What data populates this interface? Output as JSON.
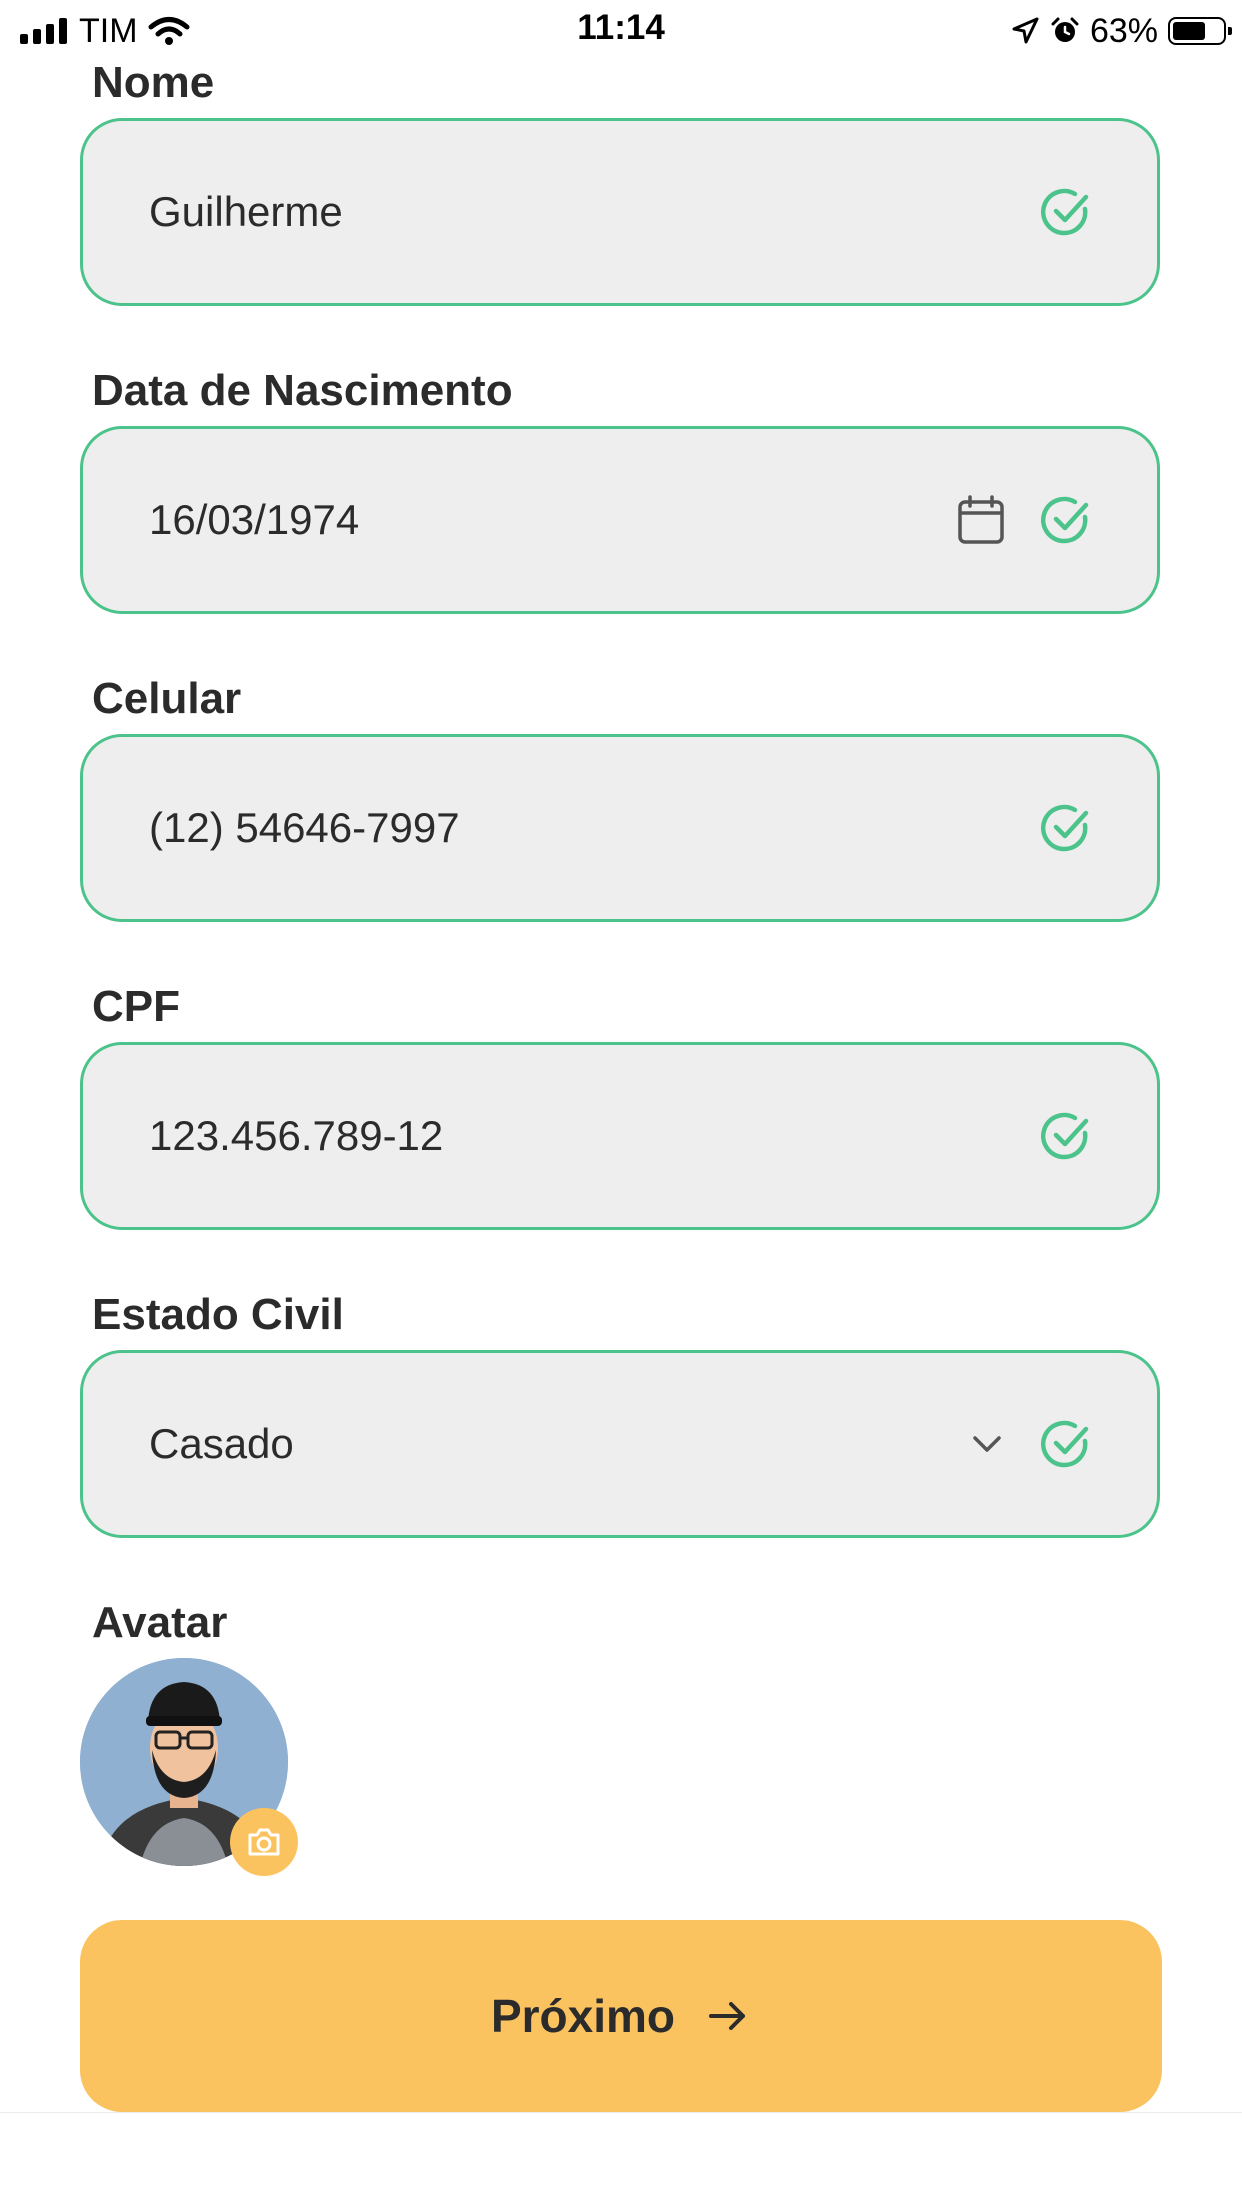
{
  "status_bar": {
    "carrier": "TIM",
    "time": "11:14",
    "battery": "63%"
  },
  "form": {
    "fields": [
      {
        "label": "Nome",
        "value": "Guilherme"
      },
      {
        "label": "Data de Nascimento",
        "value": "16/03/1974"
      },
      {
        "label": "Celular",
        "value": "(12) 54646-7997"
      },
      {
        "label": "CPF",
        "value": "123.456.789-12"
      },
      {
        "label": "Estado Civil",
        "value": "Casado"
      }
    ],
    "avatar_label": "Avatar"
  },
  "next_button": {
    "label": "Próximo"
  },
  "colors": {
    "valid_border": "#4cc38a",
    "field_bg": "#eeeeee",
    "accent": "#fbc35f"
  },
  "icons": {
    "valid": "check-circle-icon",
    "date": "calendar-icon",
    "select": "chevron-down-icon",
    "photo": "camera-icon",
    "next": "arrow-right-icon"
  }
}
